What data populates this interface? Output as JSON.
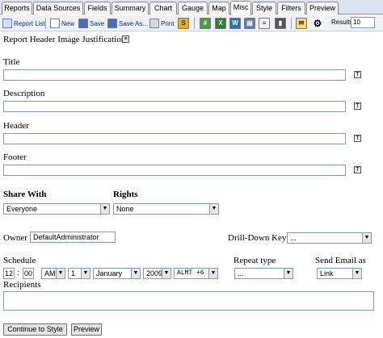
{
  "tabs": [
    "Reports",
    "Data Sources",
    "Fields",
    "Summary",
    "Chart",
    "Gauge",
    "Map",
    "Misc",
    "Style",
    "Filters",
    "Preview"
  ],
  "active_tab": "Misc",
  "toolbar": {
    "report_list": "Report List",
    "new": "New",
    "save": "Save",
    "save_as": "Save As...",
    "print": "Print",
    "results_label": "Results",
    "results_value": "10"
  },
  "form": {
    "header_image_justification_label": "Report Header Image Justification:",
    "title_label": "Title",
    "title_value": "",
    "description_label": "Description",
    "description_value": "",
    "header_label": "Header",
    "header_value": "",
    "footer_label": "Footer",
    "footer_value": "",
    "share_with_label": "Share With",
    "share_with_value": "Everyone",
    "rights_label": "Rights",
    "rights_value": "None",
    "owner_label": "Owner",
    "owner_value": "DefaultAdministrator",
    "drilldown_label": "Drill-Down Key",
    "drilldown_value": "...",
    "schedule_label": "Schedule",
    "schedule_hour": "12",
    "schedule_colon": ":",
    "schedule_minute": "00",
    "schedule_ampm": "AM",
    "schedule_day": "1",
    "schedule_month": "January",
    "schedule_year": "2009",
    "schedule_tz": "ALMT +6",
    "repeat_type_label": "Repeat type",
    "repeat_type_value": "...",
    "send_email_label": "Send Email as",
    "send_email_value": "Link",
    "recipients_label": "Recipients"
  },
  "buttons": {
    "continue": "Continue to  Style",
    "preview": "Preview"
  },
  "colors": {
    "tab_bar": "#dde4ef",
    "toolbar": "#eef2f8",
    "input_border": "#7f9db9"
  }
}
